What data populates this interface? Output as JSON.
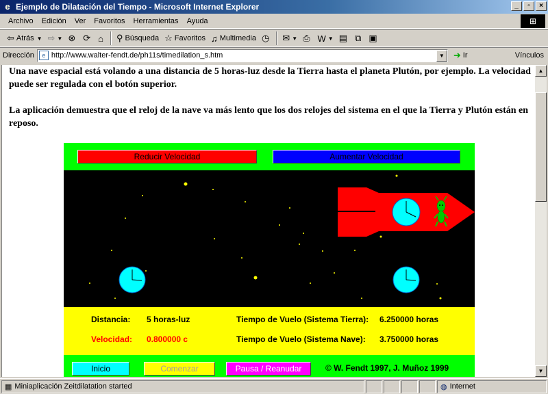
{
  "window": {
    "title": "Ejemplo de Dilatación del Tiempo - Microsoft Internet Explorer",
    "icon": "ie-icon"
  },
  "menu": {
    "items": [
      "Archivo",
      "Edición",
      "Ver",
      "Favoritos",
      "Herramientas",
      "Ayuda"
    ]
  },
  "toolbar": {
    "back": "Atrás",
    "search": "Búsqueda",
    "favorites": "Favoritos",
    "multimedia": "Multimedia"
  },
  "address": {
    "label": "Dirección",
    "url": "http://www.walter-fendt.de/ph11s/timedilation_s.htm",
    "go": "Ir",
    "links": "Vínculos"
  },
  "page": {
    "para1": "Una nave espacial está volando a una distancia de 5 horas-luz desde la Tierra hasta el planeta Plutón, por ejemplo. La velocidad puede ser regulada con el botón superior.",
    "para2": "La aplicación demuestra que el reloj de la nave va más lento que los dos relojes del sistema en el que la Tierra y Plutón están en reposo."
  },
  "applet": {
    "btn_reduce": "Reducir Velocidad",
    "btn_increase": "Aumentar Velocidad",
    "distance_label": "Distancia:",
    "distance_value": "5 horas-luz",
    "speed_label": "Velocidad:",
    "speed_value": "0.800000 c",
    "time_earth_label": "Tiempo de Vuelo (Sistema Tierra):",
    "time_earth_value": "6.250000 horas",
    "time_ship_label": "Tiempo de Vuelo (Sistema Nave):",
    "time_ship_value": "3.750000 horas",
    "btn_start": "Inicio",
    "btn_begin": "Comenzar",
    "btn_pause": "Pausa / Reanudar",
    "copyright": "© W. Fendt 1997,  J. Muñoz 1999"
  },
  "status": {
    "message": "Miniaplicación Zeitdilatation started",
    "zone": "Internet"
  },
  "colors": {
    "space": "#000000",
    "ship": "#ff0000",
    "clock": "#00ffff",
    "alien": "#00cc00",
    "star": "#ffff00"
  }
}
